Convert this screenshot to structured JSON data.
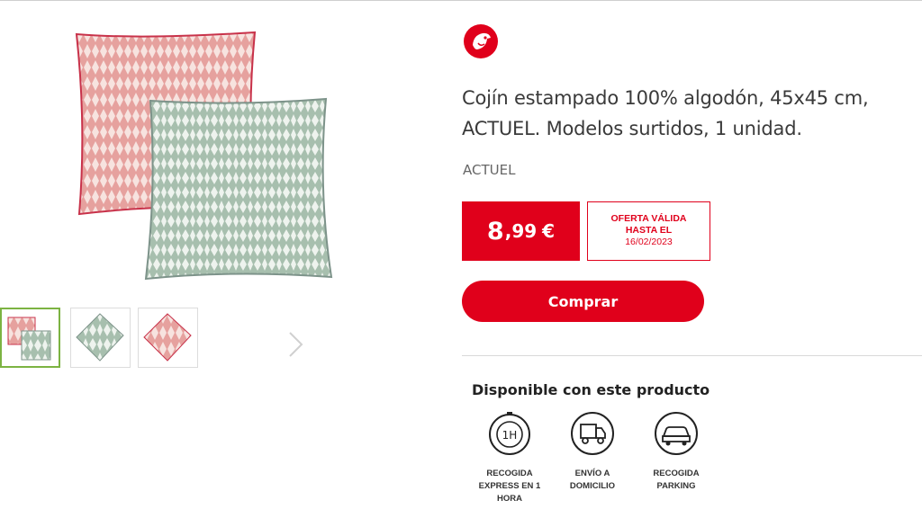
{
  "gallery": {
    "thumbnails": [
      {
        "name": "thumb-both-cushions",
        "active": true
      },
      {
        "name": "thumb-green-cushion",
        "active": false
      },
      {
        "name": "thumb-pink-cushion",
        "active": false
      }
    ],
    "next_icon": "chevron-right-icon"
  },
  "store": {
    "logo_icon": "bird-logo-icon",
    "brand_color": "#e0001b"
  },
  "product": {
    "title": "Cojín estampado 100% algodón, 45x45 cm, ACTUEL. Modelos surtidos, 1 unidad.",
    "brand": "ACTUEL",
    "price_int": "8",
    "price_dec": ",99",
    "currency": "€",
    "offer_line1": "OFERTA VÁLIDA",
    "offer_line2": "HASTA EL",
    "offer_date": "16/02/2023",
    "buy_label": "Comprar"
  },
  "availability": {
    "title": "Disponible con este producto",
    "services": [
      {
        "label": "RECOGIDA EXPRESS EN 1 HORA",
        "icon": "express-1h-icon"
      },
      {
        "label": "ENVÍO A DOMICILIO",
        "icon": "delivery-truck-icon"
      },
      {
        "label": "RECOGIDA PARKING",
        "icon": "parking-car-icon"
      }
    ]
  },
  "colors": {
    "pink": "#e8a3a0",
    "green": "#a9c1b1",
    "active_border": "#7cb342"
  }
}
